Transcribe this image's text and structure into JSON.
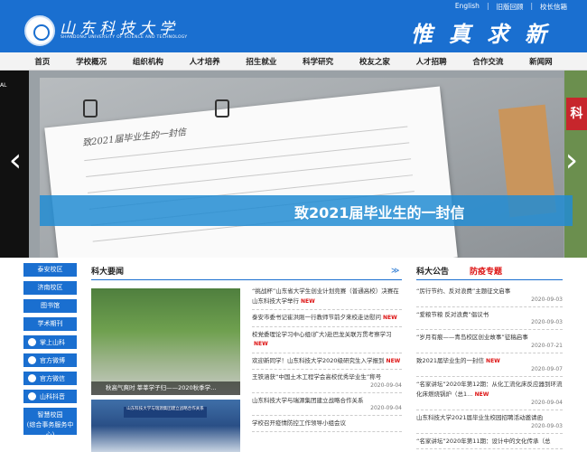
{
  "top_links": [
    "English",
    "旧版回顾",
    "校长信箱"
  ],
  "logo": {
    "cn": "山东科技大学",
    "en": "SHANDONG UNIVERSITY OF SCIENCE AND TECHNOLOGY"
  },
  "motto": "惟真求新",
  "nav": [
    "首页",
    "学校概况",
    "组织机构",
    "人才培养",
    "招生就业",
    "科学研究",
    "校友之家",
    "人才招聘",
    "合作交流",
    "新闻网"
  ],
  "banner": {
    "caption": "致2021届毕业生的一封信",
    "left_strip_text": "AL",
    "right_strip_text": "科",
    "letter_heading": "致2021届毕业生的一封信"
  },
  "sidebar": {
    "campus": [
      "泰安校区",
      "济南校区",
      "图书馆",
      "学术期刊"
    ],
    "social": [
      "掌上山科",
      "官方微博",
      "官方微信",
      "山科抖音"
    ],
    "big": [
      {
        "line1": "智慧校园",
        "line2": "(综合事务服务中心)"
      }
    ]
  },
  "news": {
    "title": "科大要闻",
    "photo1_caption": "秋高气爽时 莘莘学子归——2020秋季学…",
    "photo2_title": "山东科技大学与瑞源集团建立战略合作关系",
    "items": [
      {
        "text": "“挑战杯”山东省大学生创业计划竞赛（普通高校）决赛在山东科技大学举行",
        "new": "NEW",
        "date": ""
      },
      {
        "text": "泰安市委书记崔洪刚一行教师节前夕来校走访慰问",
        "new": "NEW",
        "date": ""
      },
      {
        "text": "校党委理论学习中心组(扩大)赴巴龙关联万贯考察学习",
        "new": "NEW",
        "date": ""
      },
      {
        "text": "欢迎新同学！山东科技大学2020级研究生入学报到",
        "new": "NEW",
        "date": ""
      },
      {
        "text": "王铁涵获“中国土木工程学会高校优秀毕业生”称号",
        "new": "",
        "date": "2020-09-04"
      },
      {
        "text": "山东科技大学与瑞源集团建立战略合作关系",
        "new": "",
        "date": "2020-09-04"
      },
      {
        "text": "学校召开疫情防控工作领导小组会议",
        "new": "",
        "date": ""
      }
    ]
  },
  "announce": {
    "title": "科大公告",
    "title2": "防疫专题",
    "items": [
      {
        "text": "“厉行节约、反对浪费”主题征文启事",
        "new": "",
        "date": "2020-09-03"
      },
      {
        "text": "“爱粮节粮 反对浪费”倡议书",
        "new": "",
        "date": "2020-09-03"
      },
      {
        "text": "“岁月有痕——青岛校区创业故事”征稿启事",
        "new": "",
        "date": "2020-07-21"
      },
      {
        "text": "致2021届毕业生的一封信",
        "new": "NEW",
        "date": "2020-09-07"
      },
      {
        "text": "“名家讲坛”2020年第12期：从化工流化床反应器到环流化床燃烧锅炉（总1…",
        "new": "NEW",
        "date": "2020-09-04"
      },
      {
        "text": "山东科技大学2021届毕业生校园招聘活动邀请函",
        "new": "",
        "date": "2020-09-03"
      },
      {
        "text": "“名家讲坛”2020年第11期：设计中的文化传承（总",
        "new": "",
        "date": ""
      }
    ]
  },
  "colors": {
    "brand_blue": "#1a6fd0",
    "new_red": "#dd1111"
  }
}
